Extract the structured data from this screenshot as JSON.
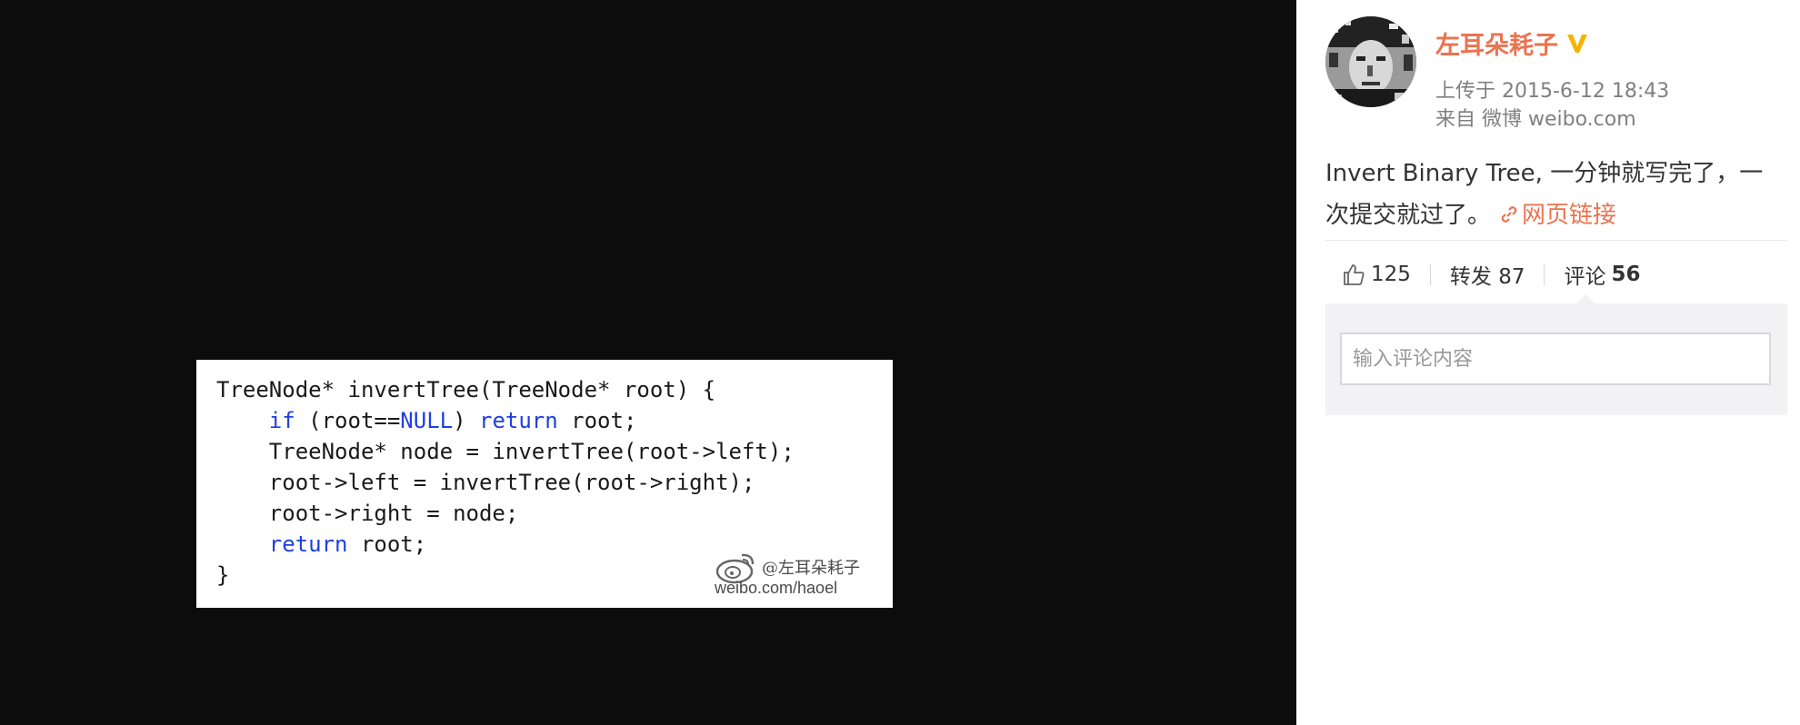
{
  "code": {
    "lines": [
      [
        {
          "t": "TreeNode* invertTree(TreeNode* root) {"
        }
      ],
      [
        {
          "t": "    "
        },
        {
          "t": "if",
          "k": 1
        },
        {
          "t": " (root=="
        },
        {
          "t": "NULL",
          "k": 1
        },
        {
          "t": ") "
        },
        {
          "t": "return",
          "k": 1
        },
        {
          "t": " root;"
        }
      ],
      [
        {
          "t": "    TreeNode* node = invertTree(root->left);"
        }
      ],
      [
        {
          "t": "    root->left = invertTree(root->right);"
        }
      ],
      [
        {
          "t": "    root->right = node;"
        }
      ],
      [
        {
          "t": "    "
        },
        {
          "t": "return",
          "k": 1
        },
        {
          "t": " root;"
        }
      ],
      [
        {
          "t": "}"
        }
      ]
    ],
    "watermark_name": "@左耳朵耗子",
    "watermark_url": "weibo.com/haoel",
    "keyword_color": "#1f3fe0"
  },
  "post": {
    "username": "左耳朵耗子",
    "verified_icon": "verified-v-icon",
    "upload_time": "上传于 2015-6-12 18:43",
    "source": "来自 微博 weibo.com",
    "text": "Invert Binary Tree, 一分钟就写完了，一次提交就过了。",
    "link_label": "网页链接",
    "link_icon": "link-icon",
    "accent_color": "#eb7350"
  },
  "actions": {
    "like_count": "125",
    "repost_label": "转发 87",
    "comment_label": "评论",
    "comment_count": "56"
  },
  "comment": {
    "placeholder": "输入评论内容"
  }
}
